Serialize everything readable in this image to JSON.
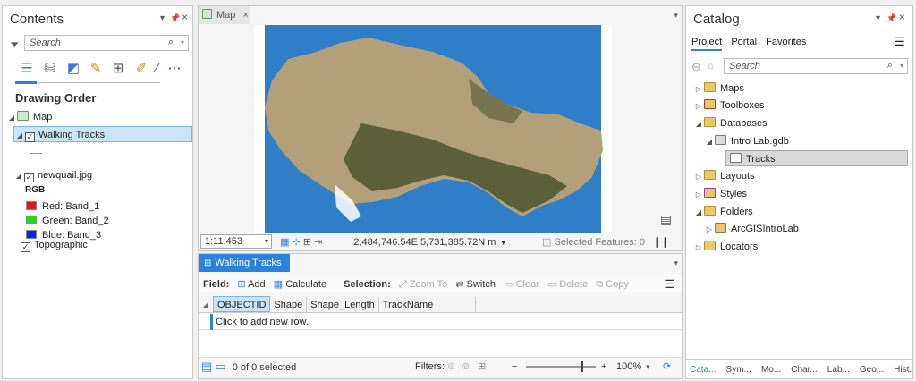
{
  "contents": {
    "title": "Contents",
    "search_placeholder": "Search",
    "drawing_order_label": "Drawing Order",
    "map_label": "Map",
    "layers": [
      {
        "name": "Walking Tracks",
        "checked": true
      },
      {
        "name": "newquail.jpg",
        "checked": true
      },
      {
        "name": "Topographic",
        "checked": true
      }
    ],
    "rgb_label": "RGB",
    "bands": [
      {
        "label": "Red:",
        "value": "Band_1",
        "color": "#e81123"
      },
      {
        "label": "Green:",
        "value": "Band_2",
        "color": "#16e016"
      },
      {
        "label": "Blue:",
        "value": "Band_3",
        "color": "#0a22f0"
      }
    ]
  },
  "map": {
    "tab_label": "Map",
    "scale": "1:11,453",
    "coords": "2,484,746.54E 5,731,385.72N m",
    "selected_features": "Selected Features: 0"
  },
  "table": {
    "tab_label": "Walking Tracks",
    "field_label": "Field:",
    "add_label": "Add",
    "calculate_label": "Calculate",
    "selection_label": "Selection:",
    "zoom_to_label": "Zoom To",
    "switch_label": "Switch",
    "clear_label": "Clear",
    "delete_label": "Delete",
    "copy_label": "Copy",
    "columns": [
      "OBJECTID",
      "Shape",
      "Shape_Length",
      "TrackName"
    ],
    "new_row_hint": "Click to add new row.",
    "selected_count": "0 of 0 selected",
    "filters_label": "Filters:",
    "zoom_pct": "100%",
    "zoom_level": 0.8
  },
  "catalog": {
    "title": "Catalog",
    "tabs": [
      "Project",
      "Portal",
      "Favorites"
    ],
    "search_placeholder": "Search",
    "items": [
      "Maps",
      "Toolboxes",
      "Databases",
      "Intro Lab.gdb",
      "Tracks",
      "Layouts",
      "Styles",
      "Folders",
      "ArcGISIntroLab",
      "Locators"
    ],
    "bottom_tabs": [
      "Cata...",
      "Sym...",
      "Mo...",
      "Char...",
      "Lab...",
      "Geo...",
      "Hist..."
    ]
  },
  "colors": {
    "accent": "#2b82d9",
    "selection": "#cce4f7",
    "water": "#2e7fc8",
    "land": "#b3a07a"
  }
}
